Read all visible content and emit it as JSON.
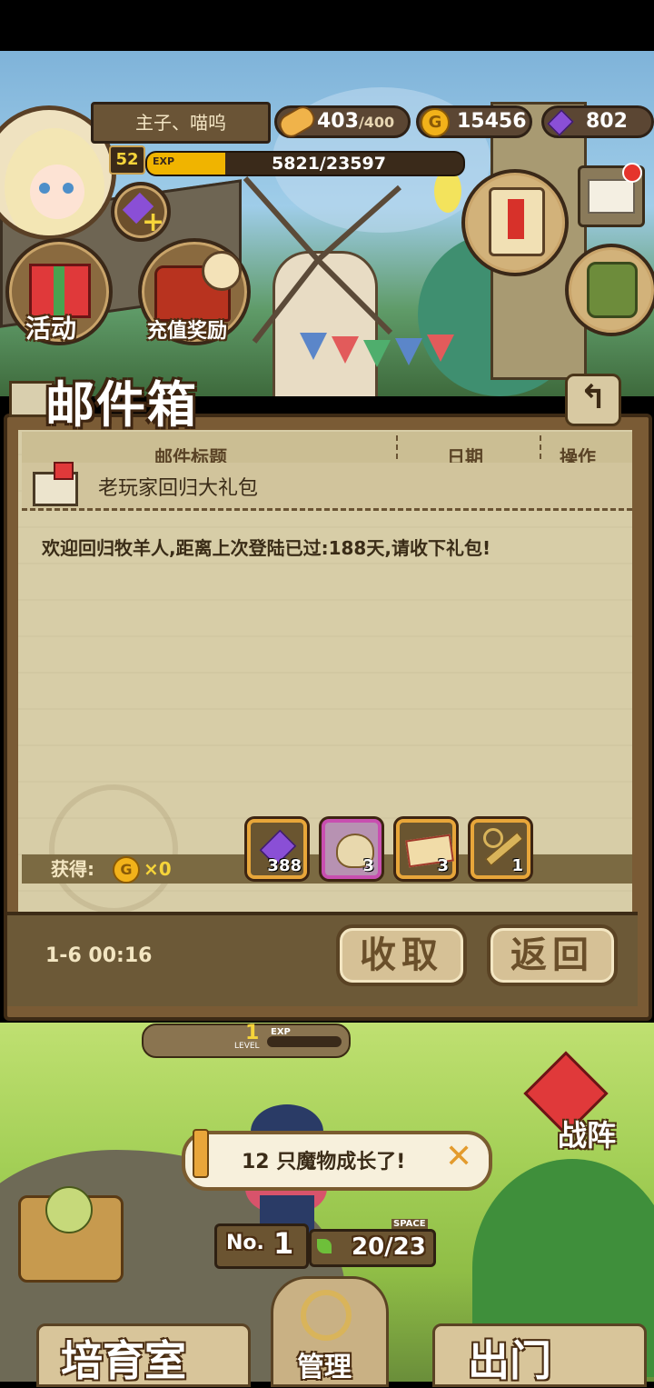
{
  "player": {
    "name": "主子、喵呜",
    "level": "52",
    "exp_label": "EXP",
    "exp_text": "5821/23597",
    "exp_progress": 0.2467
  },
  "resources": {
    "stamina_current": "403",
    "stamina_max": "/400",
    "gold": "15456",
    "gems": "802"
  },
  "top_buttons": {
    "activity": "活动",
    "recharge": "充值奖励"
  },
  "mailbox": {
    "title": "邮件箱",
    "headers": {
      "subject": "邮件标题",
      "date": "日期",
      "action": "操作"
    },
    "mail_subject": "老玩家回归大礼包",
    "mail_body": "欢迎回归牧羊人,距离上次登陆已过:188天,请收下礼包!",
    "reward_label": "获得:",
    "gold_reward": "×0",
    "items": [
      {
        "icon": "gem-icon",
        "count": "388",
        "border": "#e8a63a"
      },
      {
        "icon": "gold-bag-icon",
        "count": "3",
        "border": "#c84fb0"
      },
      {
        "icon": "ticket-icon",
        "count": "3",
        "border": "#e8a63a"
      },
      {
        "icon": "key-icon",
        "count": "1",
        "border": "#e8a63a"
      }
    ],
    "timestamp": "1-6 00:16",
    "collect_label": "收取",
    "back_label": "返回"
  },
  "bottom": {
    "level_label": "LEVEL",
    "level_value": "1",
    "exp_label": "EXP",
    "notice_text": "12 只魔物成长了!",
    "formation_label": "战阵",
    "rank_label": "No.",
    "rank_value": "1",
    "space_label": "SPACE",
    "space_value": "20/23",
    "nursery_label": "培育室",
    "manage_label": "管理",
    "outing_label": "出门"
  },
  "colors": {
    "gold": "#f2b21a",
    "gem": "#8a4fd6",
    "exp_fill": "#f0b400",
    "panel_bg": "#d7cda7"
  }
}
